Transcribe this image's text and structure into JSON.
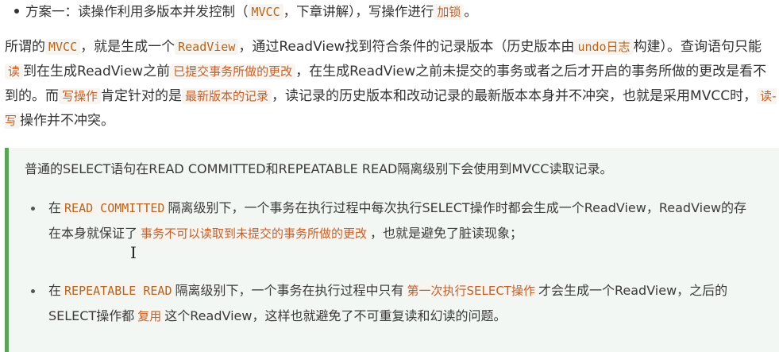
{
  "top": {
    "t1": "方案一：读操作利用多版本并发控制（",
    "c1": "MVCC",
    "t2": "，下章讲解），写操作进行",
    "c2": "加锁",
    "t3": "。"
  },
  "para": {
    "t1": "所谓的",
    "c1": "MVCC",
    "t2": "，就是生成一个",
    "c2": "ReadView",
    "t3": "，通过ReadView找到符合条件的记录版本（历史版本由",
    "c3": "undo日志",
    "t4": "构建）。查询语句只能",
    "c4": "读",
    "t5": "到在生成ReadView之前",
    "c5": "已提交事务所做的更改",
    "t6": "，在生成ReadView之前未提交的事务或者之后才开启的事务所做的更改是看不到的。而",
    "c6": "写操作",
    "t7": "肯定针对的是",
    "c7": "最新版本的记录",
    "t8": "，读记录的历史版本和改动记录的最新版本本身并不冲突，也就是采用MVCC时，",
    "c8": "读-写",
    "t9": "操作并不冲突。"
  },
  "quote": {
    "intro": "普通的SELECT语句在READ COMMITTED和REPEATABLE READ隔离级别下会使用到MVCC读取记录。",
    "item1": {
      "t1": "在",
      "c1": "READ COMMITTED",
      "t2": "隔离级别下，一个事务在执行过程中每次执行SELECT操作时都会生成一个ReadView，ReadView的存在本身就保证了",
      "c2": "事务不可以读取到未提交的事务所做的更改",
      "t3": "，也就是避免了脏读现象；"
    },
    "item2": {
      "t1": "在",
      "c1": "REPEATABLE READ",
      "t2": "隔离级别下，一个事务在执行过程中只有",
      "c2": "第一次执行SELECT操作",
      "t3": "才会生成一个ReadView，之后的SELECT操作都",
      "c3": "复用",
      "t4": "这个ReadView，这样也就避免了不可重复读和幻读的问题。"
    }
  },
  "cursor": "I"
}
